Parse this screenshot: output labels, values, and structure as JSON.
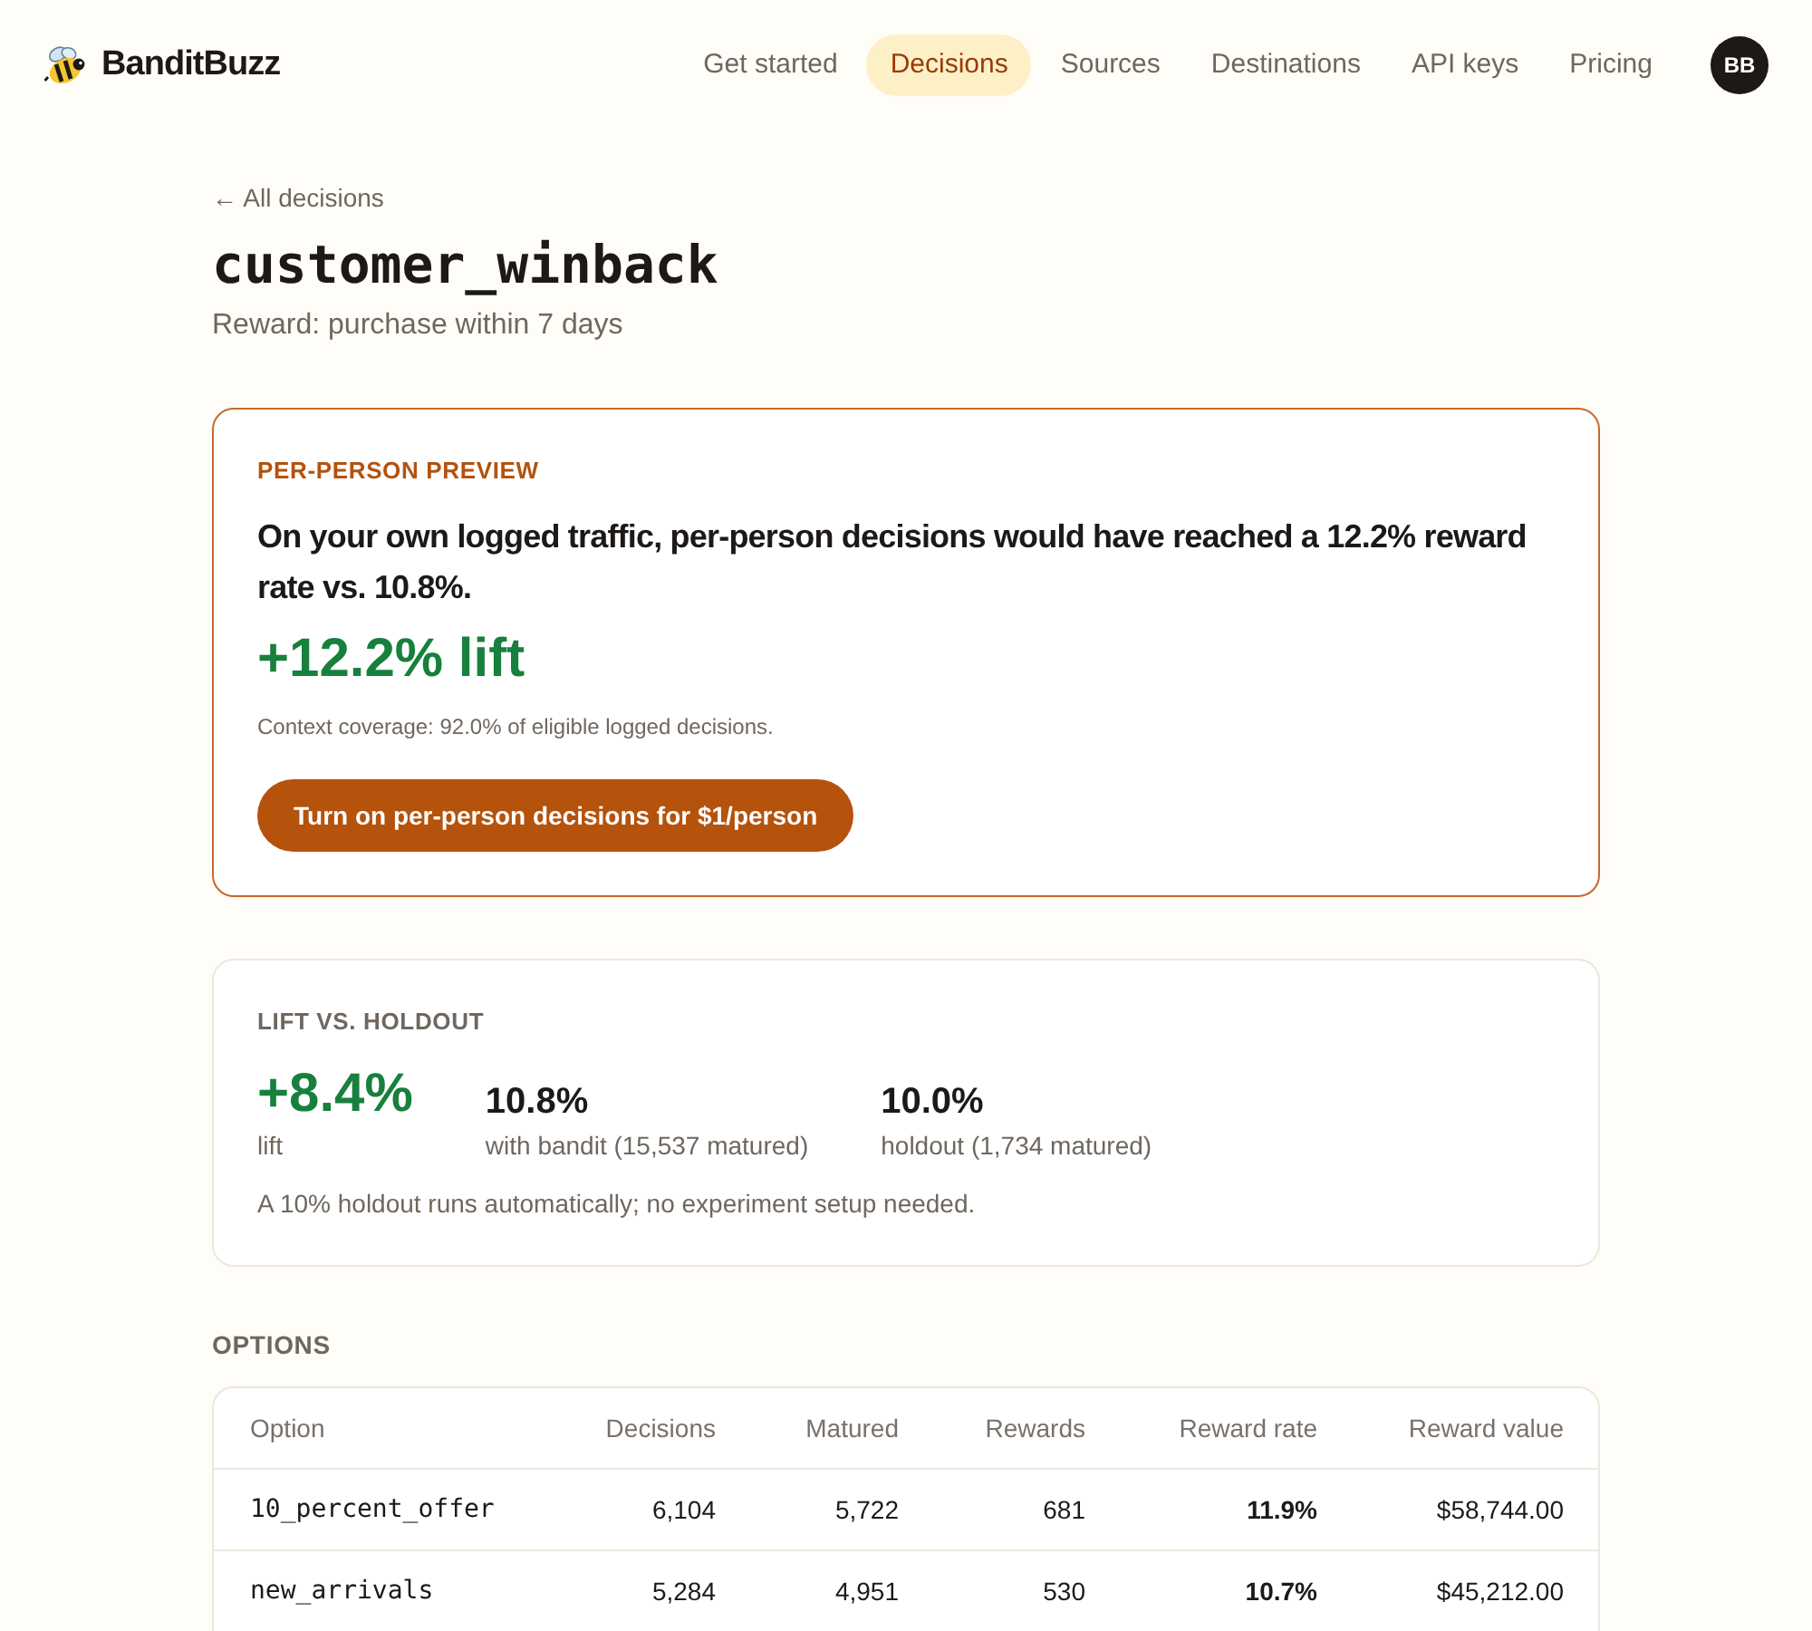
{
  "nav": {
    "brand": "BanditBuzz",
    "items": [
      {
        "label": "Get started",
        "selected": false
      },
      {
        "label": "Decisions",
        "selected": true
      },
      {
        "label": "Sources",
        "selected": false
      },
      {
        "label": "Destinations",
        "selected": false
      },
      {
        "label": "API keys",
        "selected": false
      },
      {
        "label": "Pricing",
        "selected": false
      }
    ],
    "avatar": "BB"
  },
  "back_link": "← All decisions",
  "title": "customer_winback",
  "subtitle": "Reward: purchase within 7 days",
  "preview": {
    "label": "PER-PERSON PREVIEW",
    "text": "On your own logged traffic, per-person decisions would have reached a 12.2% reward rate vs. 10.8%.",
    "lift": "+12.2% lift",
    "coverage": "Context coverage: 92.0% of eligible logged decisions.",
    "button": "Turn on per-person decisions for $1/person"
  },
  "holdout": {
    "label": "LIFT VS. HOLDOUT",
    "stats": [
      {
        "kind": "lift",
        "value": "+8.4%",
        "label": "lift"
      },
      {
        "kind": "rate",
        "value": "10.8%",
        "label": "with bandit (15,537 matured)"
      },
      {
        "kind": "rate",
        "value": "10.0%",
        "label": "holdout (1,734 matured)"
      }
    ],
    "note": "A 10% holdout runs automatically; no experiment setup needed."
  },
  "options": {
    "heading": "OPTIONS",
    "columns": [
      {
        "label": "Option",
        "kind": "code"
      },
      {
        "label": "Decisions",
        "kind": "number"
      },
      {
        "label": "Matured",
        "kind": "number"
      },
      {
        "label": "Rewards",
        "kind": "number"
      },
      {
        "label": "Reward rate",
        "kind": "rate"
      },
      {
        "label": "Reward value",
        "kind": "number"
      }
    ],
    "rows": [
      [
        "10_percent_offer",
        "6,104",
        "5,722",
        "681",
        "11.9%",
        "$58,744.00"
      ],
      [
        "new_arrivals",
        "5,284",
        "4,951",
        "530",
        "10.7%",
        "$45,212.00"
      ]
    ]
  }
}
